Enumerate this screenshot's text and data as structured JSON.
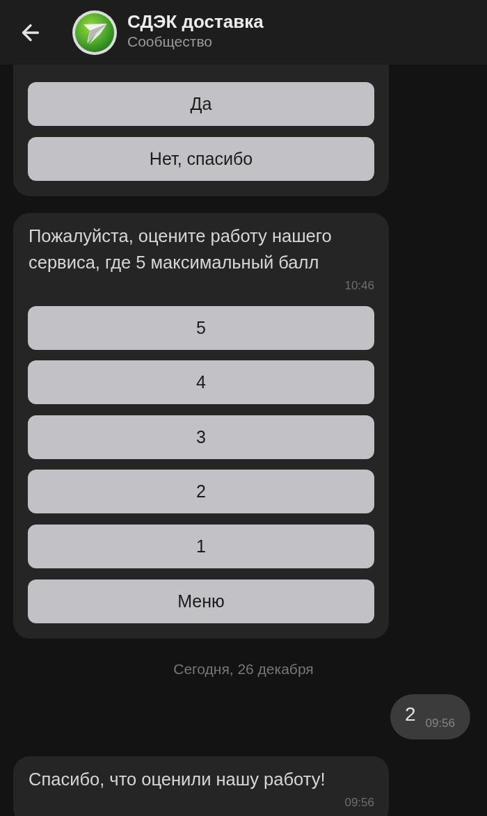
{
  "header": {
    "title": "СДЭК доставка",
    "subtitle": "Сообщество"
  },
  "messages": [
    {
      "kind": "incoming",
      "buttons": [
        "Да",
        "Нет, спасибо"
      ]
    },
    {
      "kind": "incoming",
      "text": "Пожалуйста, оцените работу нашего сервиса, где 5 максимальный балл",
      "time": "10:46",
      "buttons": [
        "5",
        "4",
        "3",
        "2",
        "1",
        "Меню"
      ]
    },
    {
      "kind": "date",
      "text": "Сегодня, 26 декабря"
    },
    {
      "kind": "outgoing",
      "text": "2",
      "time": "09:56"
    },
    {
      "kind": "incoming",
      "text": "Спасибо, что оценили нашу работу!",
      "time": "09:56"
    }
  ]
}
